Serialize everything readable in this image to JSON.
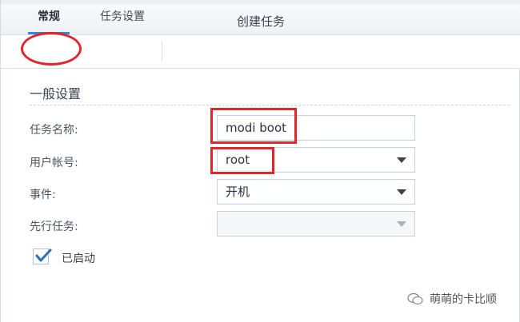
{
  "window": {
    "title": "创建任务"
  },
  "tabs": [
    {
      "label": "常规",
      "active": true
    },
    {
      "label": "任务设置",
      "active": false
    }
  ],
  "section": {
    "title": "一般设置"
  },
  "form": {
    "task_name": {
      "label": "任务名称:",
      "value": "modi boot"
    },
    "user_account": {
      "label": "用户帐号:",
      "value": "root"
    },
    "event": {
      "label": "事件:",
      "value": "开机"
    },
    "pre_task": {
      "label": "先行任务:",
      "value": ""
    }
  },
  "enabled": {
    "label": "已启动",
    "checked": true
  },
  "watermark": {
    "text": "萌萌的卡比顺"
  },
  "colors": {
    "accent": "#2f8be0",
    "annotation_red": "#e3262b"
  }
}
